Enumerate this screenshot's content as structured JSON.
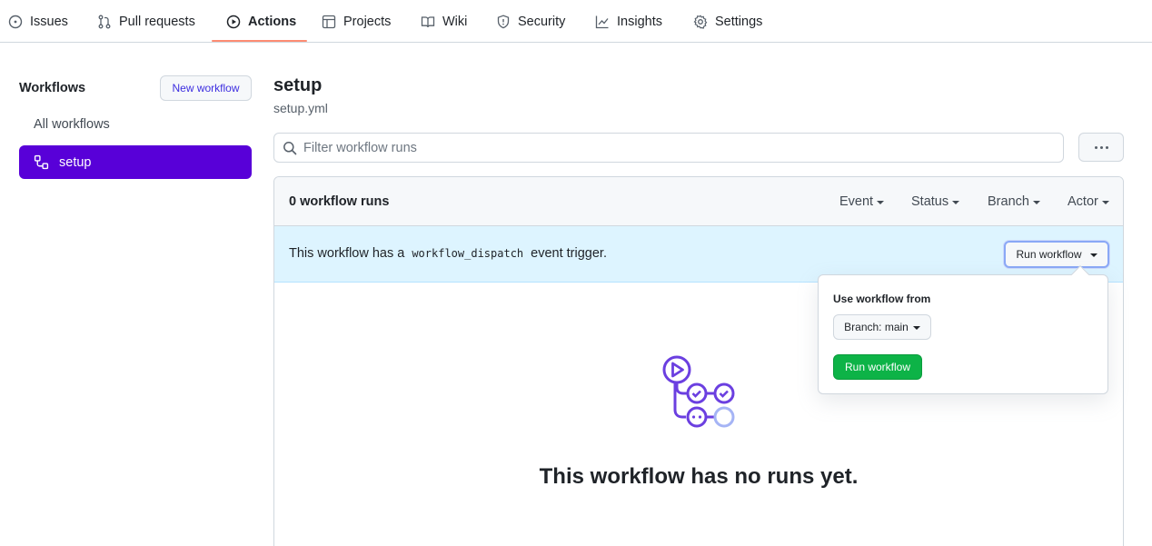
{
  "nav": {
    "tabs": [
      {
        "label": "Issues",
        "icon": "issue-opened-icon"
      },
      {
        "label": "Pull requests",
        "icon": "git-pull-request-icon"
      },
      {
        "label": "Actions",
        "icon": "play-icon",
        "active": true
      },
      {
        "label": "Projects",
        "icon": "table-icon"
      },
      {
        "label": "Wiki",
        "icon": "book-icon"
      },
      {
        "label": "Security",
        "icon": "shield-icon"
      },
      {
        "label": "Insights",
        "icon": "graph-icon"
      },
      {
        "label": "Settings",
        "icon": "gear-icon"
      }
    ]
  },
  "sidebar": {
    "title": "Workflows",
    "new_workflow": "New workflow",
    "all_workflows": "All workflows",
    "selected_workflow": "setup"
  },
  "main": {
    "title": "setup",
    "file": "setup.yml",
    "filter_placeholder": "Filter workflow runs",
    "runs_count": "0 workflow runs",
    "filters": [
      "Event",
      "Status",
      "Branch",
      "Actor"
    ],
    "dispatch": {
      "before": "This workflow has a",
      "code": "workflow_dispatch",
      "after": "event trigger.",
      "button": "Run workflow"
    },
    "empty_text": "This workflow has no runs yet."
  },
  "popover": {
    "title": "Use workflow from",
    "branch_button": "Branch: main",
    "run_button": "Run workflow"
  },
  "colors": {
    "accent_purple": "#5800d8",
    "tab_underline": "#fd8c73",
    "run_green": "#0db347",
    "dispatch_bg": "#ddf4ff"
  }
}
